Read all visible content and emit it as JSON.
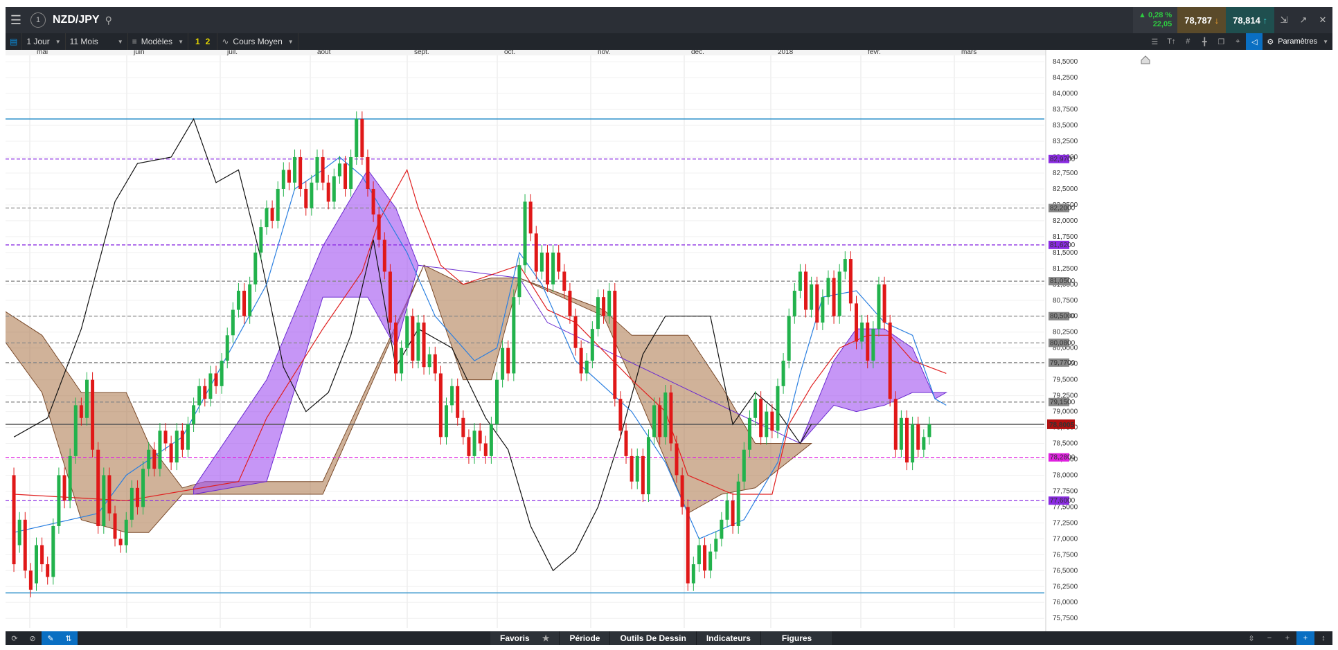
{
  "header": {
    "symbol": "NZD/JPY",
    "change_pct": "0,28 %",
    "change_pts": "22,05",
    "bid": "78,787",
    "ask": "78,814"
  },
  "toolbar": {
    "timeframe": "1 Jour",
    "range": "11 Mois",
    "templates": "Modèles",
    "layout_1": "1",
    "layout_2": "2",
    "price_type": "Cours Moyen",
    "settings": "Paramètres"
  },
  "bottom": {
    "tabs": [
      "Favoris",
      "Période",
      "Outils De Dessin",
      "Indicateurs",
      "Figures"
    ]
  },
  "chart_data": {
    "type": "candlestick",
    "months": [
      "mai",
      "juin",
      "juil.",
      "août",
      "sept.",
      "oct.",
      "nov.",
      "déc.",
      "2018",
      "févr.",
      "mars"
    ],
    "y_ticks": [
      "84,5000",
      "84,2500",
      "84,0000",
      "83,7500",
      "83,5000",
      "83,2500",
      "83,0000",
      "82,7500",
      "82,5000",
      "82,2500",
      "82,0000",
      "81,7500",
      "81,5000",
      "81,2500",
      "81,0000",
      "80,7500",
      "80,5000",
      "80,2500",
      "80,0000",
      "79,7500",
      "79,5000",
      "79,2500",
      "79,0000",
      "78,7500",
      "78,5000",
      "78,2500",
      "78,0000",
      "77,7500",
      "77,5000",
      "77,2500",
      "77,0000",
      "76,7500",
      "76,5000",
      "76,2500",
      "76,0000",
      "75,7500"
    ],
    "ylim": [
      75.6,
      84.6
    ],
    "current_price": "78,8005",
    "horizontal_lines": [
      {
        "value": 83.6,
        "color": "#2a8fc9",
        "style": "solid",
        "label": ""
      },
      {
        "value": 82.97,
        "color": "#8a2be2",
        "style": "dashed",
        "label": "82,9700"
      },
      {
        "value": 82.2,
        "color": "#888888",
        "style": "dashed",
        "label": "82,2000"
      },
      {
        "value": 81.62,
        "color": "#8a2be2",
        "style": "dashed",
        "label": "81,6200"
      },
      {
        "value": 81.05,
        "color": "#888888",
        "style": "dashed",
        "label": "81,0500"
      },
      {
        "value": 80.5,
        "color": "#888888",
        "style": "dashed",
        "label": "80,5000"
      },
      {
        "value": 80.08,
        "color": "#888888",
        "style": "dashed",
        "label": "80,0800"
      },
      {
        "value": 79.77,
        "color": "#888888",
        "style": "dashed",
        "label": "79,7700"
      },
      {
        "value": 79.15,
        "color": "#888888",
        "style": "dashed",
        "label": "79,1500"
      },
      {
        "value": 78.8,
        "color": "#555555",
        "style": "solid",
        "label": ""
      },
      {
        "value": 78.28,
        "color": "#e020e0",
        "style": "dashed",
        "label": "78,2800"
      },
      {
        "value": 77.6,
        "color": "#8a2be2",
        "style": "dashed",
        "label": "77,6000"
      },
      {
        "value": 76.15,
        "color": "#2a8fc9",
        "style": "solid",
        "label": ""
      }
    ],
    "candles": [
      [
        78.0,
        76.6
      ],
      [
        76.9,
        77.3
      ],
      [
        77.3,
        76.5
      ],
      [
        76.5,
        76.2
      ],
      [
        76.3,
        76.9
      ],
      [
        76.9,
        76.6
      ],
      [
        76.6,
        76.4
      ],
      [
        76.4,
        77.2
      ],
      [
        77.2,
        78.0
      ],
      [
        78.0,
        77.6
      ],
      [
        77.6,
        78.3
      ],
      [
        78.3,
        79.1
      ],
      [
        79.1,
        78.9
      ],
      [
        78.9,
        79.5
      ],
      [
        79.5,
        78.4
      ],
      [
        78.4,
        77.2
      ],
      [
        77.2,
        78.0
      ],
      [
        78.0,
        77.4
      ],
      [
        77.4,
        77.0
      ],
      [
        77.0,
        76.9
      ],
      [
        76.9,
        77.3
      ],
      [
        77.3,
        77.8
      ],
      [
        77.8,
        77.5
      ],
      [
        77.5,
        78.1
      ],
      [
        78.1,
        78.4
      ],
      [
        78.4,
        78.1
      ],
      [
        78.1,
        78.7
      ],
      [
        78.7,
        78.5
      ],
      [
        78.5,
        78.2
      ],
      [
        78.2,
        78.7
      ],
      [
        78.7,
        78.4
      ],
      [
        78.4,
        78.8
      ],
      [
        78.8,
        79.1
      ],
      [
        79.1,
        79.4
      ],
      [
        79.4,
        79.2
      ],
      [
        79.2,
        79.6
      ],
      [
        79.6,
        79.4
      ],
      [
        79.4,
        79.8
      ],
      [
        79.8,
        80.2
      ],
      [
        80.2,
        80.6
      ],
      [
        80.6,
        80.9
      ],
      [
        80.9,
        80.5
      ],
      [
        80.5,
        81.0
      ],
      [
        81.0,
        81.5
      ],
      [
        81.5,
        81.9
      ],
      [
        81.9,
        82.2
      ],
      [
        82.2,
        82.0
      ],
      [
        82.0,
        82.5
      ],
      [
        82.5,
        82.8
      ],
      [
        82.8,
        82.6
      ],
      [
        82.6,
        83.0
      ],
      [
        83.0,
        82.5
      ],
      [
        82.5,
        82.2
      ],
      [
        82.2,
        82.6
      ],
      [
        82.6,
        83.0
      ],
      [
        83.0,
        82.6
      ],
      [
        82.6,
        82.3
      ],
      [
        82.3,
        82.7
      ],
      [
        82.7,
        82.9
      ],
      [
        82.9,
        82.5
      ],
      [
        82.5,
        83.0
      ],
      [
        83.0,
        83.6
      ],
      [
        83.6,
        83.0
      ],
      [
        83.0,
        82.5
      ],
      [
        82.5,
        82.1
      ],
      [
        82.1,
        81.7
      ],
      [
        81.7,
        81.2
      ],
      [
        81.2,
        80.4
      ],
      [
        80.4,
        79.6
      ],
      [
        79.6,
        80.0
      ],
      [
        80.0,
        80.5
      ],
      [
        80.5,
        79.8
      ],
      [
        79.8,
        80.4
      ],
      [
        80.4,
        79.7
      ],
      [
        79.7,
        79.9
      ],
      [
        79.9,
        79.6
      ],
      [
        79.6,
        78.6
      ],
      [
        78.6,
        79.1
      ],
      [
        79.1,
        79.4
      ],
      [
        79.4,
        78.9
      ],
      [
        78.9,
        78.6
      ],
      [
        78.6,
        78.3
      ],
      [
        78.3,
        78.7
      ],
      [
        78.7,
        78.5
      ],
      [
        78.5,
        78.3
      ],
      [
        78.3,
        78.8
      ],
      [
        78.8,
        79.5
      ],
      [
        79.5,
        80.0
      ],
      [
        80.0,
        79.6
      ],
      [
        79.6,
        80.8
      ],
      [
        80.8,
        81.3
      ],
      [
        81.3,
        82.3
      ],
      [
        82.3,
        81.8
      ],
      [
        81.8,
        81.2
      ],
      [
        81.2,
        81.5
      ],
      [
        81.5,
        81.0
      ],
      [
        81.0,
        81.5
      ],
      [
        81.5,
        81.2
      ],
      [
        81.2,
        80.9
      ],
      [
        80.9,
        80.5
      ],
      [
        80.5,
        80.0
      ],
      [
        80.0,
        79.6
      ],
      [
        79.6,
        79.8
      ],
      [
        79.8,
        80.3
      ],
      [
        80.3,
        80.8
      ],
      [
        80.8,
        80.5
      ],
      [
        80.5,
        80.9
      ],
      [
        80.9,
        79.2
      ],
      [
        79.2,
        78.7
      ],
      [
        78.7,
        78.3
      ],
      [
        78.3,
        77.9
      ],
      [
        77.9,
        78.3
      ],
      [
        78.3,
        77.7
      ],
      [
        77.7,
        78.6
      ],
      [
        78.6,
        79.1
      ],
      [
        79.1,
        78.6
      ],
      [
        78.6,
        79.3
      ],
      [
        79.3,
        78.5
      ],
      [
        78.5,
        78.0
      ],
      [
        78.0,
        77.5
      ],
      [
        77.5,
        76.3
      ],
      [
        76.3,
        76.6
      ],
      [
        76.6,
        76.9
      ],
      [
        76.9,
        76.5
      ],
      [
        76.5,
        76.8
      ],
      [
        76.8,
        77.0
      ],
      [
        77.0,
        77.3
      ],
      [
        77.3,
        77.6
      ],
      [
        77.6,
        77.2
      ],
      [
        77.2,
        77.9
      ],
      [
        77.9,
        78.4
      ],
      [
        78.4,
        78.9
      ],
      [
        78.9,
        79.2
      ],
      [
        79.2,
        78.6
      ],
      [
        78.6,
        79.0
      ],
      [
        79.0,
        78.7
      ],
      [
        78.7,
        79.4
      ],
      [
        79.4,
        79.8
      ],
      [
        79.8,
        80.5
      ],
      [
        80.5,
        80.9
      ],
      [
        80.9,
        81.2
      ],
      [
        81.2,
        80.6
      ],
      [
        80.6,
        81.0
      ],
      [
        81.0,
        80.4
      ],
      [
        80.4,
        80.8
      ],
      [
        80.8,
        81.1
      ],
      [
        81.1,
        80.5
      ],
      [
        80.5,
        81.2
      ],
      [
        81.2,
        81.4
      ],
      [
        81.4,
        80.7
      ],
      [
        80.7,
        80.1
      ],
      [
        80.1,
        80.4
      ],
      [
        80.4,
        79.8
      ],
      [
        79.8,
        80.3
      ],
      [
        80.3,
        81.0
      ],
      [
        81.0,
        80.4
      ],
      [
        80.4,
        79.2
      ],
      [
        79.2,
        78.4
      ],
      [
        78.4,
        78.9
      ],
      [
        78.9,
        78.2
      ],
      [
        78.2,
        78.8
      ],
      [
        78.8,
        78.4
      ],
      [
        78.4,
        78.6
      ],
      [
        78.6,
        78.8
      ]
    ],
    "kijun": [
      [
        0,
        77.7
      ],
      [
        20,
        77.6
      ],
      [
        40,
        77.9
      ],
      [
        45,
        78.9
      ],
      [
        55,
        80.3
      ],
      [
        62,
        81.2
      ],
      [
        65,
        82.0
      ],
      [
        70,
        82.8
      ],
      [
        72,
        82.2
      ],
      [
        76,
        81.3
      ],
      [
        80,
        81.0
      ],
      [
        90,
        81.3
      ],
      [
        95,
        80.6
      ],
      [
        100,
        80.4
      ],
      [
        110,
        79.5
      ],
      [
        116,
        79.0
      ],
      [
        120,
        78.0
      ],
      [
        128,
        77.7
      ],
      [
        135,
        77.7
      ],
      [
        138,
        78.8
      ],
      [
        142,
        79.4
      ],
      [
        147,
        80.0
      ],
      [
        152,
        80.2
      ],
      [
        156,
        80.2
      ],
      [
        160,
        79.8
      ],
      [
        166,
        79.6
      ]
    ],
    "tenkan": [
      [
        0,
        77.1
      ],
      [
        15,
        77.4
      ],
      [
        20,
        78.0
      ],
      [
        30,
        78.6
      ],
      [
        40,
        80.2
      ],
      [
        45,
        81.0
      ],
      [
        50,
        82.5
      ],
      [
        55,
        82.8
      ],
      [
        58,
        83.0
      ],
      [
        62,
        82.7
      ],
      [
        70,
        81.5
      ],
      [
        75,
        80.5
      ],
      [
        82,
        79.8
      ],
      [
        86,
        80.0
      ],
      [
        90,
        81.5
      ],
      [
        94,
        81.0
      ],
      [
        100,
        79.8
      ],
      [
        110,
        79.0
      ],
      [
        116,
        78.2
      ],
      [
        122,
        77.0
      ],
      [
        130,
        77.3
      ],
      [
        136,
        78.2
      ],
      [
        140,
        79.6
      ],
      [
        144,
        80.8
      ],
      [
        150,
        80.9
      ],
      [
        155,
        80.4
      ],
      [
        160,
        80.2
      ],
      [
        164,
        79.2
      ],
      [
        166,
        79.1
      ]
    ],
    "chikou": [
      [
        0,
        78.6
      ],
      [
        6,
        78.9
      ],
      [
        12,
        80.3
      ],
      [
        18,
        82.3
      ],
      [
        22,
        82.9
      ],
      [
        28,
        83.0
      ],
      [
        32,
        83.6
      ],
      [
        36,
        82.6
      ],
      [
        40,
        82.8
      ],
      [
        44,
        81.4
      ],
      [
        48,
        79.7
      ],
      [
        52,
        79.0
      ],
      [
        56,
        79.3
      ],
      [
        60,
        80.2
      ],
      [
        64,
        81.7
      ],
      [
        68,
        79.7
      ],
      [
        72,
        80.3
      ],
      [
        78,
        80.0
      ],
      [
        84,
        78.9
      ],
      [
        88,
        78.4
      ],
      [
        92,
        77.2
      ],
      [
        96,
        76.5
      ],
      [
        100,
        76.8
      ],
      [
        104,
        77.5
      ],
      [
        108,
        78.6
      ],
      [
        112,
        79.9
      ],
      [
        116,
        80.5
      ],
      [
        120,
        80.5
      ],
      [
        124,
        80.5
      ],
      [
        128,
        78.8
      ],
      [
        132,
        79.3
      ],
      [
        136,
        79.0
      ],
      [
        140,
        78.5
      ],
      [
        142,
        78.8
      ]
    ],
    "cloud_brown": [
      [
        -9,
        81.0,
        81.0
      ],
      [
        5,
        80.2,
        79.3
      ],
      [
        12,
        79.3,
        77.3
      ],
      [
        20,
        79.3,
        77.1
      ],
      [
        24,
        78.5,
        77.1
      ],
      [
        30,
        77.8,
        77.7
      ],
      [
        34,
        77.9,
        77.7
      ],
      [
        55,
        77.9,
        77.7
      ],
      [
        73,
        81.3,
        81.3
      ],
      [
        80,
        81.0,
        79.5
      ],
      [
        85,
        81.1,
        79.5
      ],
      [
        90,
        81.1,
        81.1
      ],
      [
        105,
        80.6,
        80.5
      ],
      [
        110,
        80.2,
        79.5
      ],
      [
        120,
        80.2,
        77.4
      ],
      [
        126,
        79.4,
        77.7
      ],
      [
        132,
        78.5,
        77.8
      ],
      [
        142,
        78.5,
        78.5
      ]
    ],
    "cloud_purple": [
      [
        32,
        77.8,
        77.7
      ],
      [
        45,
        79.5,
        77.9
      ],
      [
        55,
        81.6,
        80.8
      ],
      [
        63,
        82.8,
        80.8
      ],
      [
        68,
        82.2,
        80.0
      ],
      [
        72,
        81.3,
        81.3
      ],
      [
        90,
        81.1,
        81.1
      ],
      [
        95,
        80.4,
        80.4
      ],
      [
        140,
        78.5,
        78.5
      ],
      [
        146,
        79.8,
        79.1
      ],
      [
        150,
        80.3,
        79.0
      ],
      [
        155,
        80.3,
        79.1
      ],
      [
        160,
        80.0,
        79.3
      ],
      [
        164,
        79.2,
        79.3
      ],
      [
        166,
        79.3,
        79.3
      ]
    ]
  }
}
